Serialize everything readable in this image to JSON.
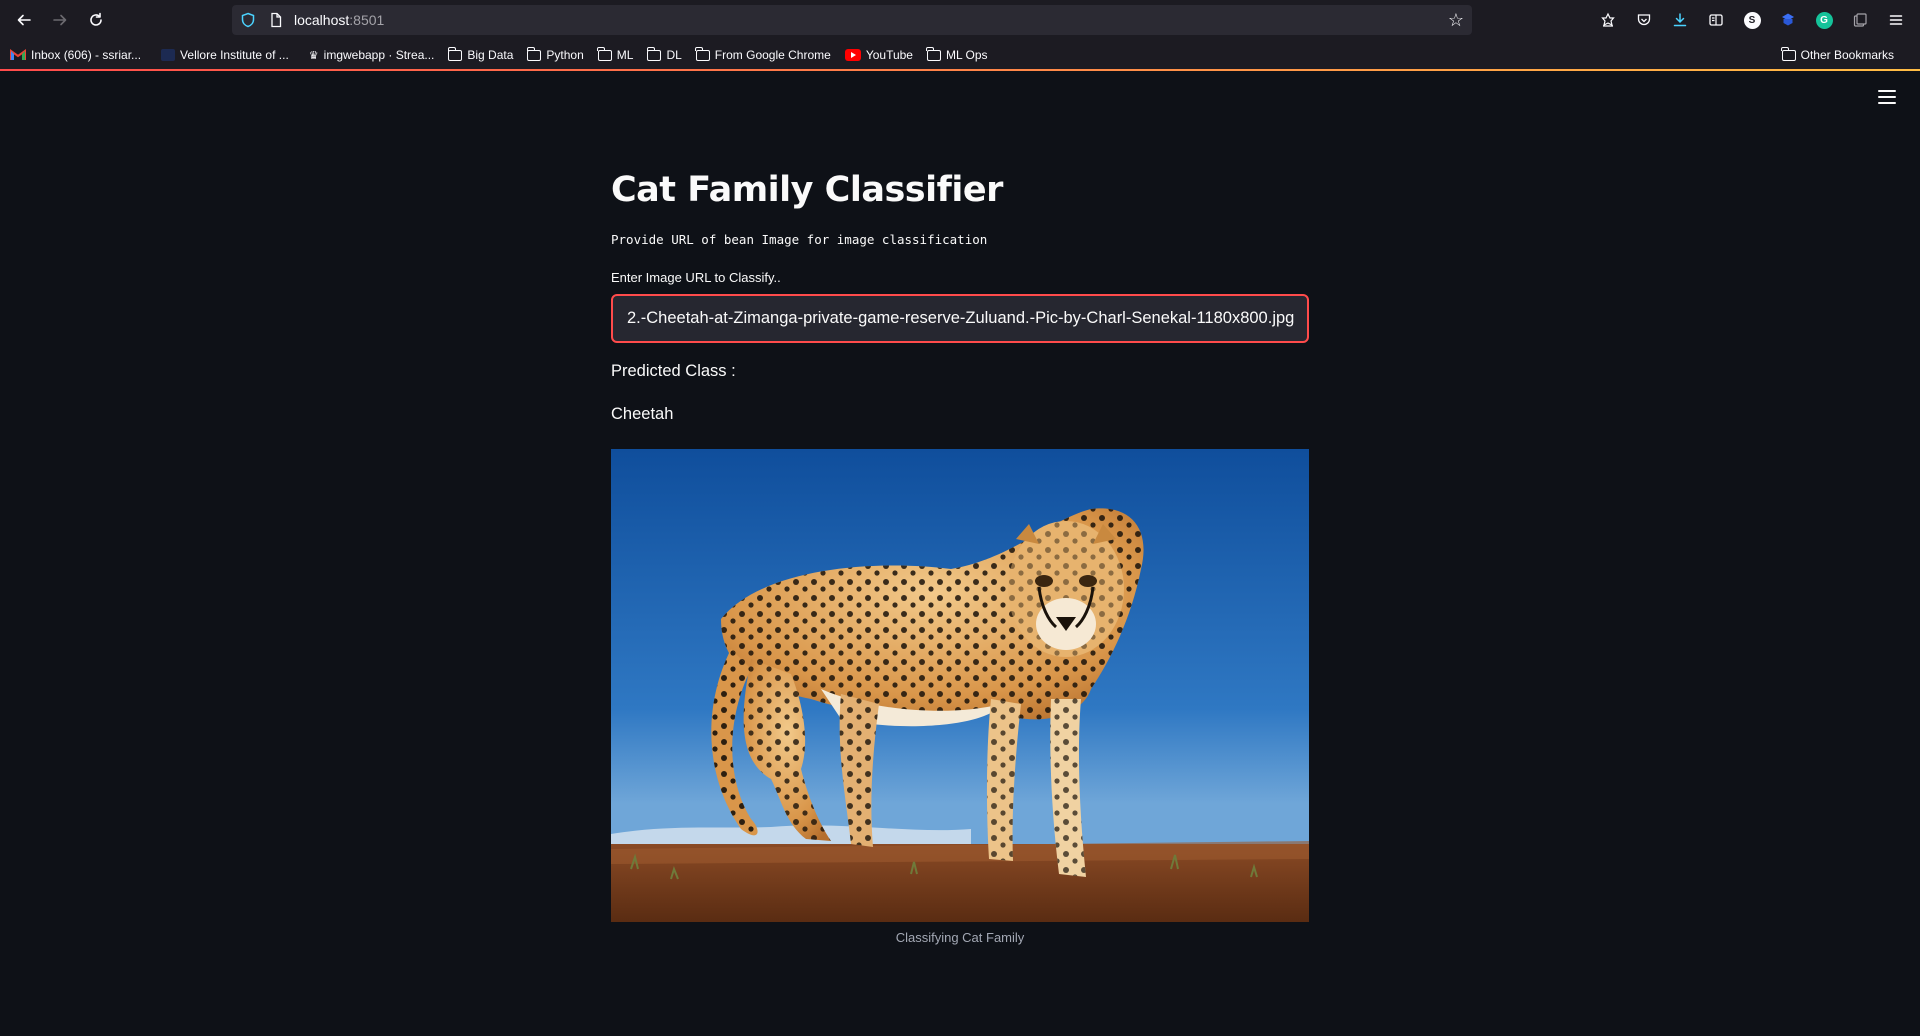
{
  "browser": {
    "url_host": "localhost",
    "url_port": ":8501",
    "bookmarks": [
      {
        "label": "Inbox (606) - ssriar...",
        "icon": "gmail-icon"
      },
      {
        "label": "Vellore Institute of ...",
        "icon": "vit-icon"
      },
      {
        "label": "imgwebapp · Strea...",
        "icon": "streamlit-icon"
      },
      {
        "label": "Big Data",
        "icon": "folder-icon"
      },
      {
        "label": "Python",
        "icon": "folder-icon"
      },
      {
        "label": "ML",
        "icon": "folder-icon"
      },
      {
        "label": "DL",
        "icon": "folder-icon"
      },
      {
        "label": "From Google Chrome",
        "icon": "folder-icon"
      },
      {
        "label": "YouTube",
        "icon": "youtube-icon"
      },
      {
        "label": "ML Ops",
        "icon": "folder-icon"
      }
    ],
    "other_bookmarks": "Other Bookmarks"
  },
  "app": {
    "title": "Cat Family Classifier",
    "subtitle": "Provide URL of bean Image for image classification",
    "input_label": "Enter Image URL to Classify..",
    "input_value": "2.-Cheetah-at-Zimanga-private-game-reserve-Zuluand.-Pic-by-Charl-Senekal-1180x800.jpg",
    "predicted_label": "Predicted Class :",
    "predicted_value": "Cheetah",
    "image_caption": "Classifying Cat Family"
  },
  "colors": {
    "background": "#0e1117",
    "accent": "#ff4b4b",
    "input_bg": "#262730"
  }
}
